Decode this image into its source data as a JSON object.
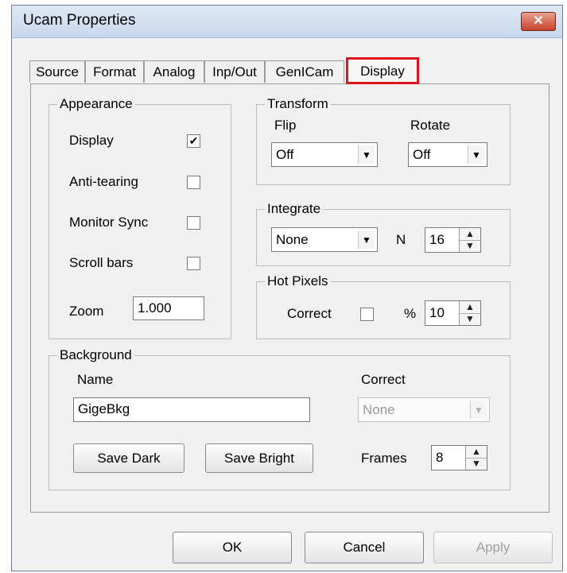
{
  "window": {
    "title": "Ucam Properties",
    "close_glyph": "✕"
  },
  "tabs": [
    "Source",
    "Format",
    "Analog",
    "Inp/Out",
    "GenICam",
    "Display"
  ],
  "active_tab": "Display",
  "appearance": {
    "legend": "Appearance",
    "display_label": "Display",
    "display_checked": "✔",
    "anti_tearing_label": "Anti-tearing",
    "monitor_sync_label": "Monitor Sync",
    "scroll_bars_label": "Scroll bars",
    "zoom_label": "Zoom",
    "zoom_value": "1.000"
  },
  "transform": {
    "legend": "Transform",
    "flip_label": "Flip",
    "flip_value": "Off",
    "rotate_label": "Rotate",
    "rotate_value": "Off"
  },
  "integrate": {
    "legend": "Integrate",
    "mode_value": "None",
    "n_label": "N",
    "n_value": "16"
  },
  "hot_pixels": {
    "legend": "Hot Pixels",
    "correct_label": "Correct",
    "percent_label": "%",
    "percent_value": "10"
  },
  "background": {
    "legend": "Background",
    "name_label": "Name",
    "name_value": "GigeBkg",
    "correct_label": "Correct",
    "correct_value": "None",
    "save_dark_label": "Save Dark",
    "save_bright_label": "Save Bright",
    "frames_label": "Frames",
    "frames_value": "8"
  },
  "footer": {
    "ok_label": "OK",
    "cancel_label": "Cancel",
    "apply_label": "Apply"
  },
  "icons": {
    "dropdown": "▼",
    "spin_up": "▲",
    "spin_down": "▼"
  },
  "colors": {
    "highlight_border": "#e0141f",
    "close_button": "#c7432c",
    "titlebar": "#dfe9f5"
  }
}
